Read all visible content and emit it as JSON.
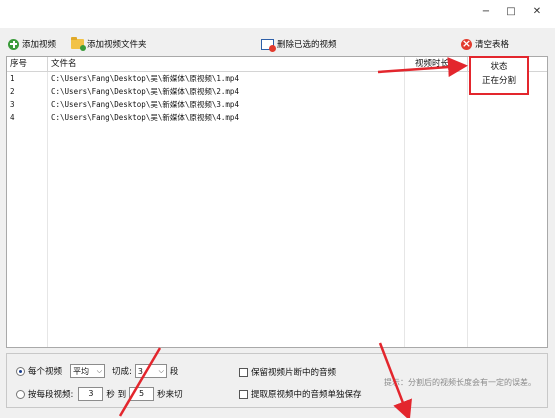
{
  "window": {
    "minimize_label": "−",
    "maximize_label": "□",
    "close_label": "✕"
  },
  "toolbar": {
    "add_video": "添加视频",
    "add_folder": "添加视频文件夹",
    "remove_selected": "删除已选的视频",
    "clear_table": "清空表格"
  },
  "table": {
    "columns": [
      "序号",
      "文件名",
      "视频时长",
      "状态"
    ],
    "rows": [
      {
        "index": "1",
        "file": "C:\\Users\\Fang\\Desktop\\吴\\新媒体\\原视频\\1.mp4"
      },
      {
        "index": "2",
        "file": "C:\\Users\\Fang\\Desktop\\吴\\新媒体\\原视频\\2.mp4"
      },
      {
        "index": "3",
        "file": "C:\\Users\\Fang\\Desktop\\吴\\新媒体\\原视频\\3.mp4"
      },
      {
        "index": "4",
        "file": "C:\\Users\\Fang\\Desktop\\吴\\新媒体\\原视频\\4.mp4"
      }
    ],
    "status_value": "正在分割"
  },
  "options": {
    "mode_each_video": "每个视频",
    "mode_select": "平均",
    "cut_label": "切成:",
    "segments_value": "3",
    "segments_unit": "段",
    "mode_by_segment": "按每段视频:",
    "from_value": "3",
    "sec_to": "秒 到",
    "to_value": "5",
    "sec_cut": "秒来切",
    "keep_audio": "保留视频片断中的音频",
    "extract_audio": "提取原视频中的音频单独保存",
    "hint": "提示：分割后的视频长度会有一定的误差。"
  },
  "colors": {
    "accent_red": "#e3262d"
  }
}
